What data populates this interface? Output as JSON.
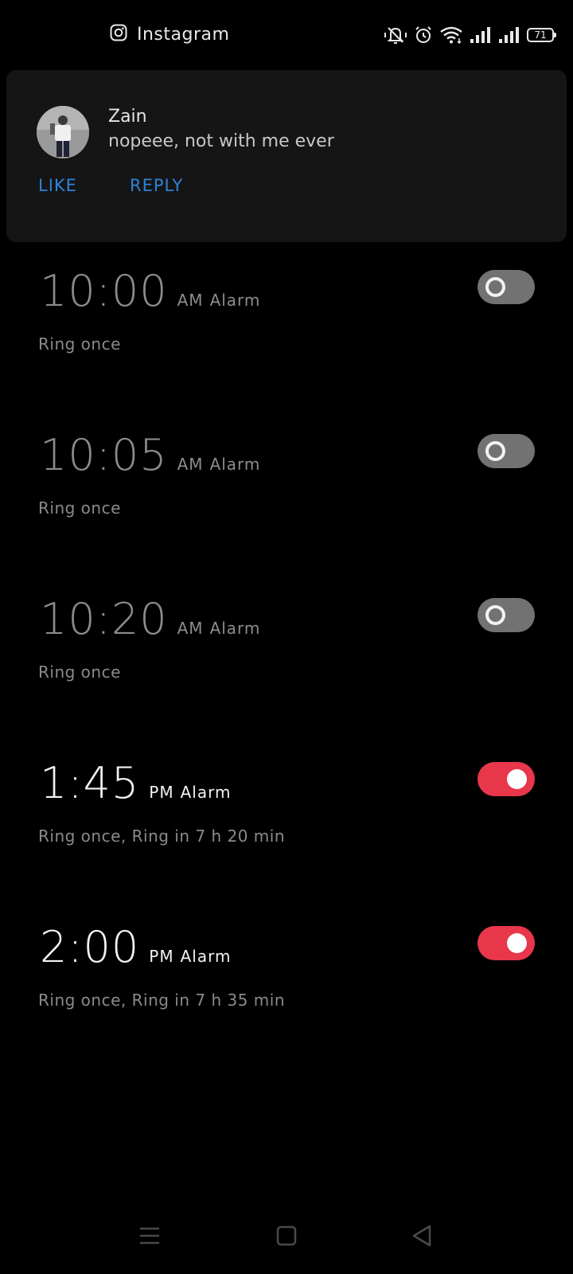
{
  "status_bar": {
    "app_name": "Instagram",
    "app_icon": "instagram-icon",
    "icons": [
      "mute-icon",
      "alarm-icon",
      "wifi-icon",
      "signal-icon",
      "signal-icon"
    ],
    "battery_level": "71"
  },
  "notification": {
    "sender": "Zain",
    "message": "nopeee, not with me ever",
    "actions": {
      "like": "LIKE",
      "reply": "REPLY"
    },
    "action_color": "#2f83d6"
  },
  "alarms": [
    {
      "time": "10:00",
      "meridiem": "AM",
      "label": "Alarm",
      "subtitle": "Ring once",
      "enabled": false
    },
    {
      "time": "10:05",
      "meridiem": "AM",
      "label": "Alarm",
      "subtitle": "Ring once",
      "enabled": false
    },
    {
      "time": "10:20",
      "meridiem": "AM",
      "label": "Alarm",
      "subtitle": "Ring once",
      "enabled": false
    },
    {
      "time": "1:45",
      "meridiem": "PM",
      "label": "Alarm",
      "subtitle": "Ring once, Ring in 7 h 20 min",
      "enabled": true
    },
    {
      "time": "2:00",
      "meridiem": "PM",
      "label": "Alarm",
      "subtitle": "Ring once, Ring in 7 h 35 min",
      "enabled": true
    }
  ],
  "colors": {
    "toggle_on": "#e8374a",
    "toggle_off": "#727272",
    "background": "#000000"
  },
  "nav_bar": {
    "icons": [
      "menu-icon",
      "home-icon",
      "back-icon"
    ]
  }
}
